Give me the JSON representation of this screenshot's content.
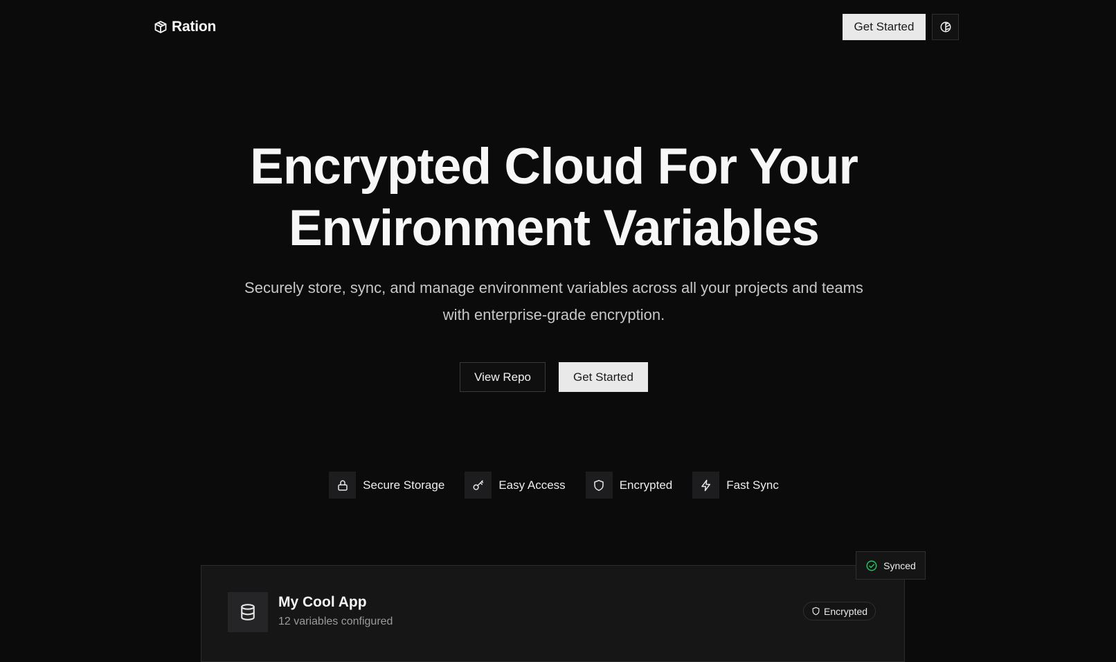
{
  "header": {
    "brand_name": "Ration",
    "get_started_label": "Get Started",
    "theme_toggle_icon": "contrast-icon"
  },
  "hero": {
    "title_line1": "Encrypted Cloud For Your",
    "title_line2": "Environment Variables",
    "subtitle_line1": "Securely store, sync, and manage environment variables across all your projects and teams",
    "subtitle_line2": "with enterprise-grade encryption.",
    "view_repo_label": "View Repo",
    "get_started_label": "Get Started"
  },
  "features": [
    {
      "label": "Secure Storage",
      "icon": "lock-icon"
    },
    {
      "label": "Easy Access",
      "icon": "key-icon"
    },
    {
      "label": "Encrypted",
      "icon": "shield-icon"
    },
    {
      "label": "Fast Sync",
      "icon": "lightning-icon"
    }
  ],
  "app_card": {
    "name": "My Cool App",
    "meta": "12 variables configured",
    "encrypted_label": "Encrypted",
    "synced_label": "Synced",
    "synced_color": "#22c55e"
  }
}
